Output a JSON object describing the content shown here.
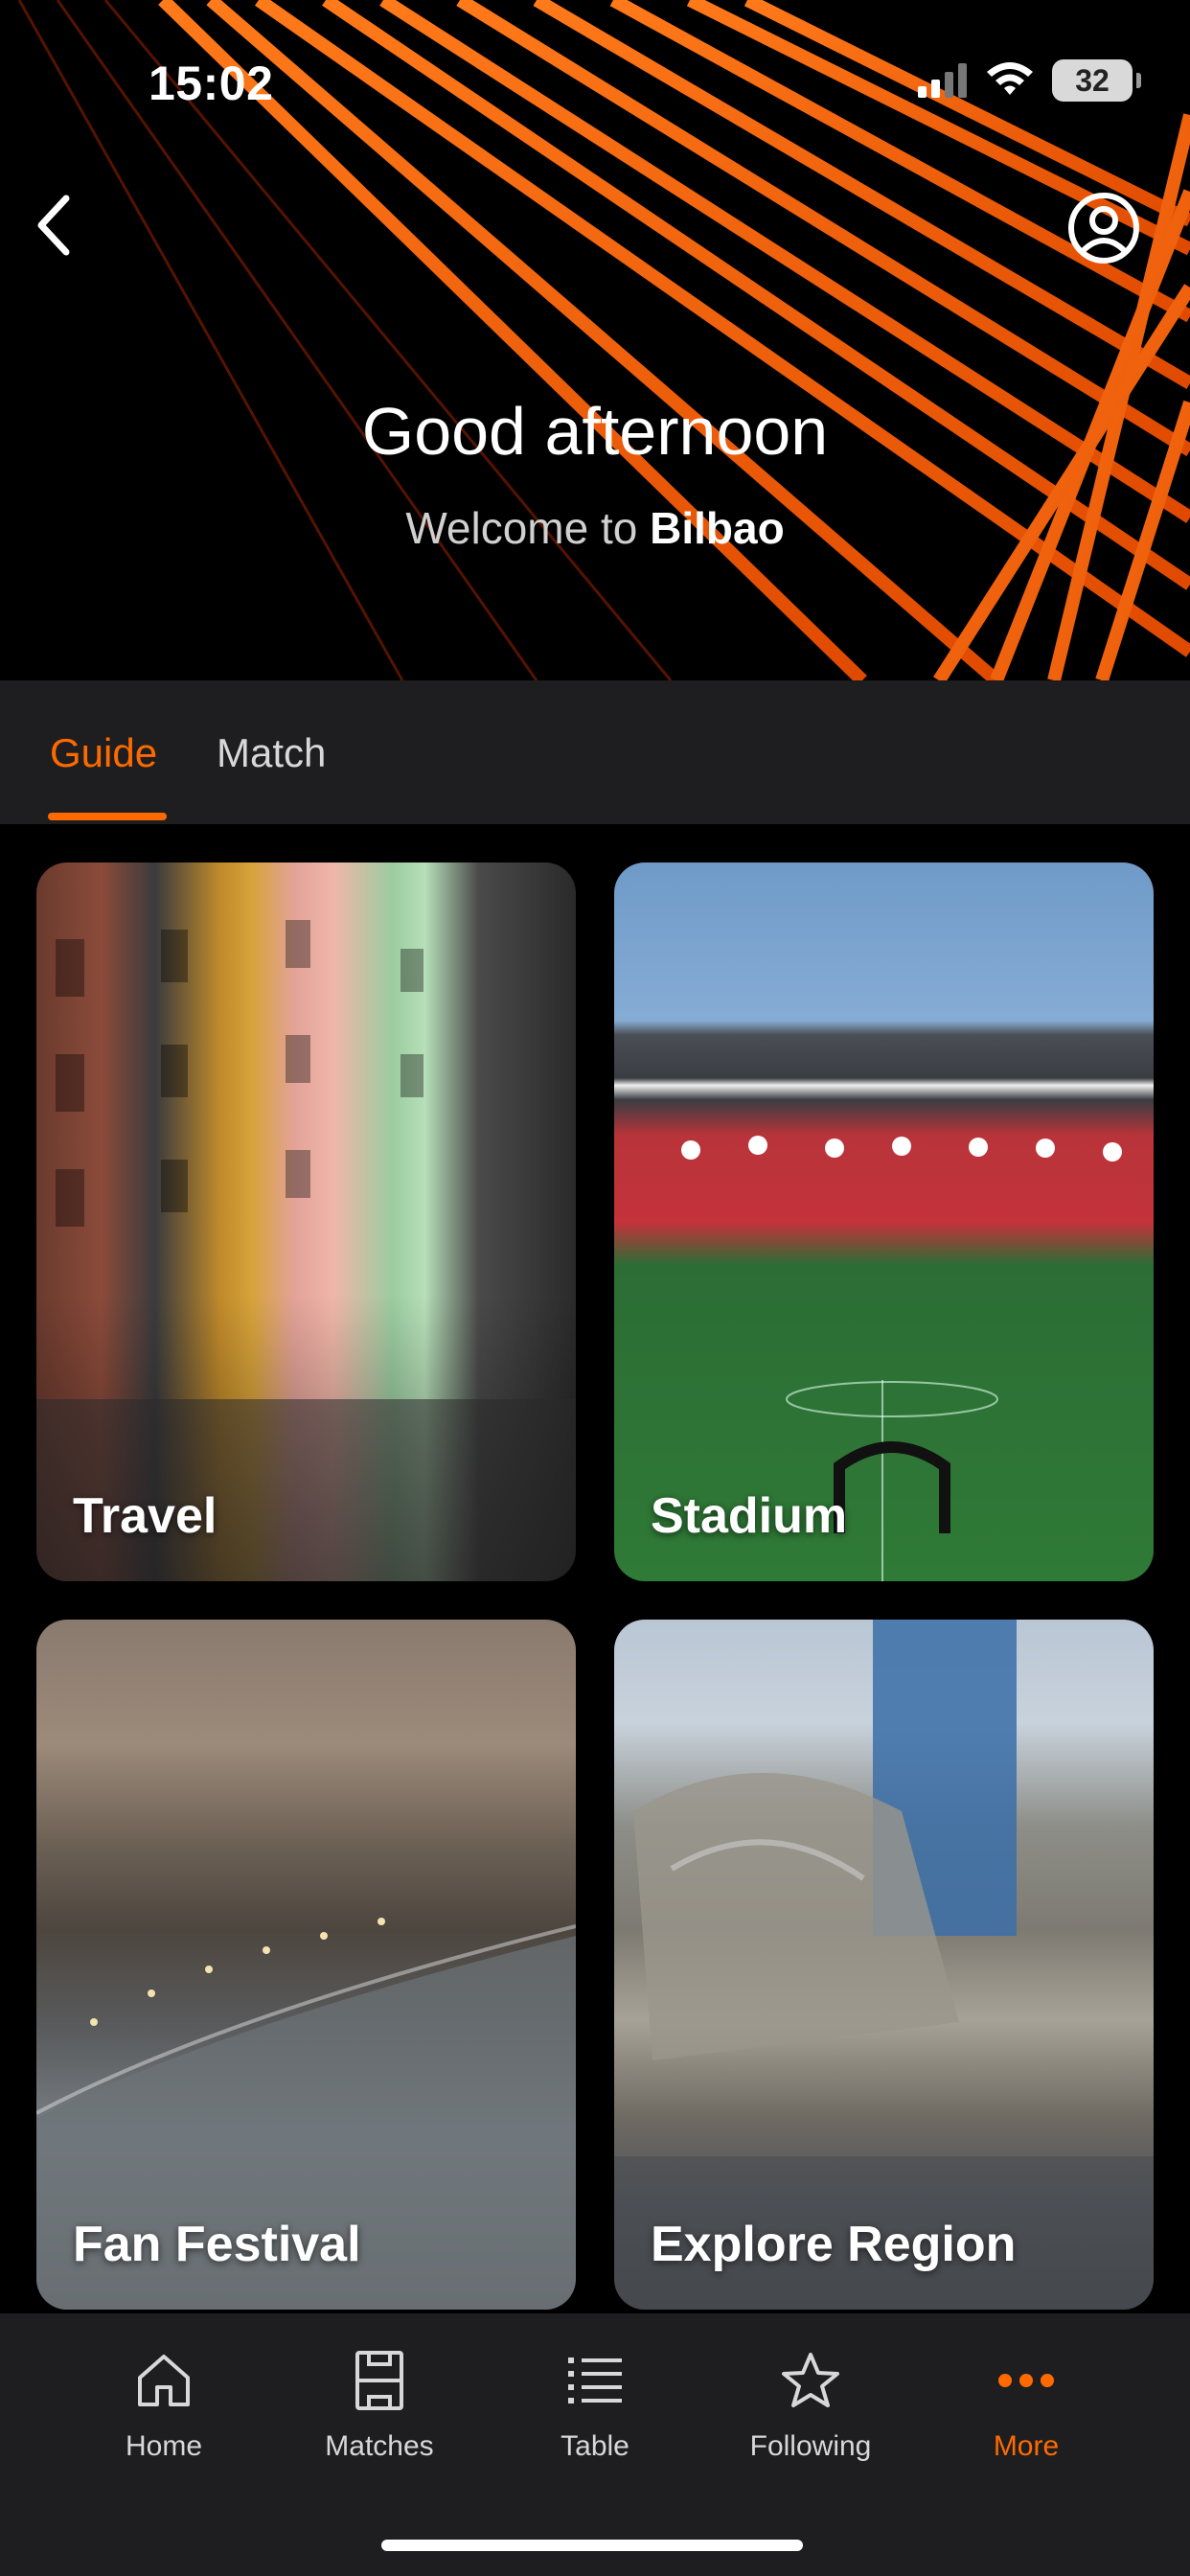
{
  "status_bar": {
    "time": "15:02",
    "battery": "32"
  },
  "header": {
    "greeting": "Good afternoon",
    "welcome_prefix": "Welcome to",
    "city": "Bilbao"
  },
  "tabs": [
    {
      "label": "Guide",
      "active": true
    },
    {
      "label": "Match",
      "active": false
    }
  ],
  "cards": [
    {
      "label": "Travel"
    },
    {
      "label": "Stadium"
    },
    {
      "label": "Fan Festival"
    },
    {
      "label": "Explore Region"
    }
  ],
  "bottom_nav": [
    {
      "label": "Home",
      "icon": "home-icon"
    },
    {
      "label": "Matches",
      "icon": "pitch-icon"
    },
    {
      "label": "Table",
      "icon": "list-icon"
    },
    {
      "label": "Following",
      "icon": "star-icon"
    },
    {
      "label": "More",
      "icon": "more-dots-icon",
      "active": true
    }
  ],
  "colors": {
    "accent": "#ff6a00",
    "surface": "#1e1e20",
    "background": "#000000"
  }
}
